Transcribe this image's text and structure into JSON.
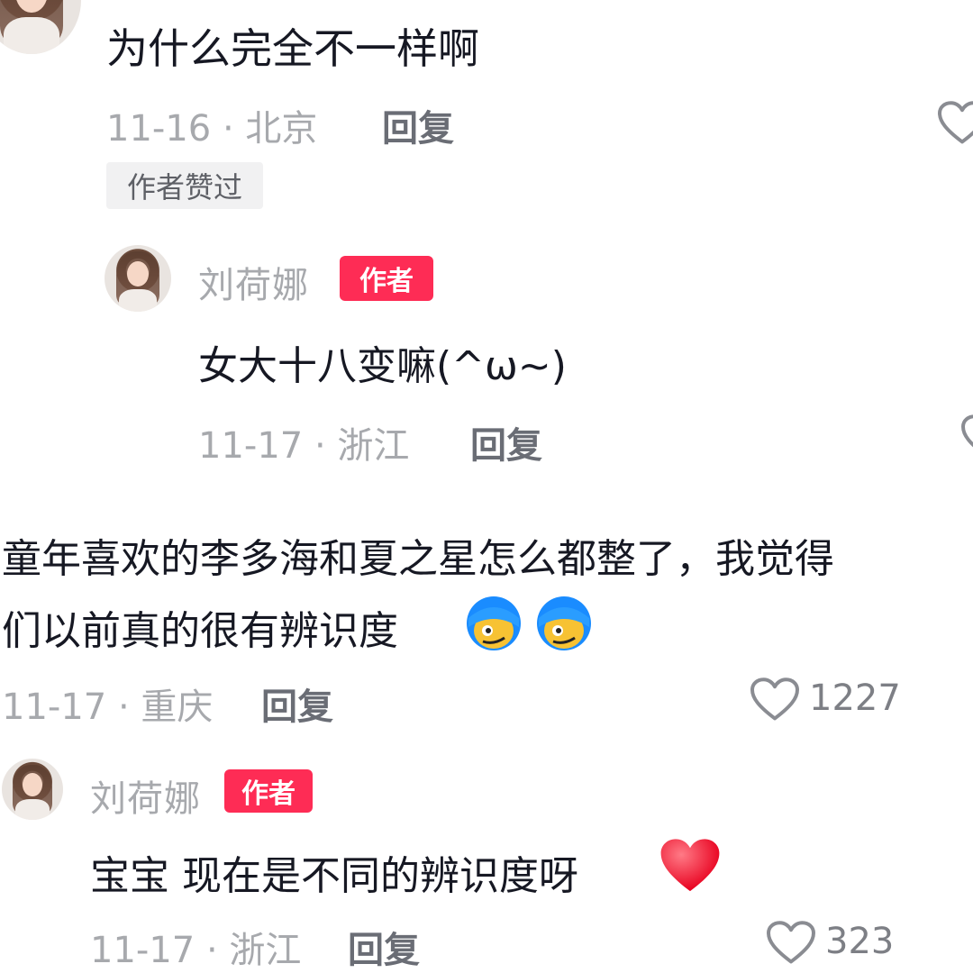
{
  "comments": [
    {
      "text": "为什么完全不一样啊",
      "date_location": "11-16 · 北京",
      "reply_label": "回复",
      "tag": "作者赞过"
    },
    {
      "author": "刘荷娜",
      "author_badge": "作者",
      "text": "女大十八变嘛(^ω~)",
      "date_location": "11-17 · 浙江",
      "reply_label": "回复"
    },
    {
      "text_line1": "童年喜欢的李多海和夏之星怎么都整了，我觉得",
      "text_line2": "们以前真的很有辨识度",
      "date_location": "11-17 · 重庆",
      "reply_label": "回复",
      "likes": "1227"
    },
    {
      "author": "刘荷娜",
      "author_badge": "作者",
      "text": "宝宝 现在是不同的辨识度呀",
      "date_location": "11-17 · 浙江",
      "reply_label": "回复",
      "likes": "323"
    }
  ],
  "icons": [
    "heart-outline-icon",
    "red-heart-emoji",
    "blue-hair-face-emoji"
  ],
  "colors": {
    "author_badge": "#fe2c55",
    "meta_text": "#a7a9ad",
    "heart_emoji": "#ff1f3d"
  }
}
